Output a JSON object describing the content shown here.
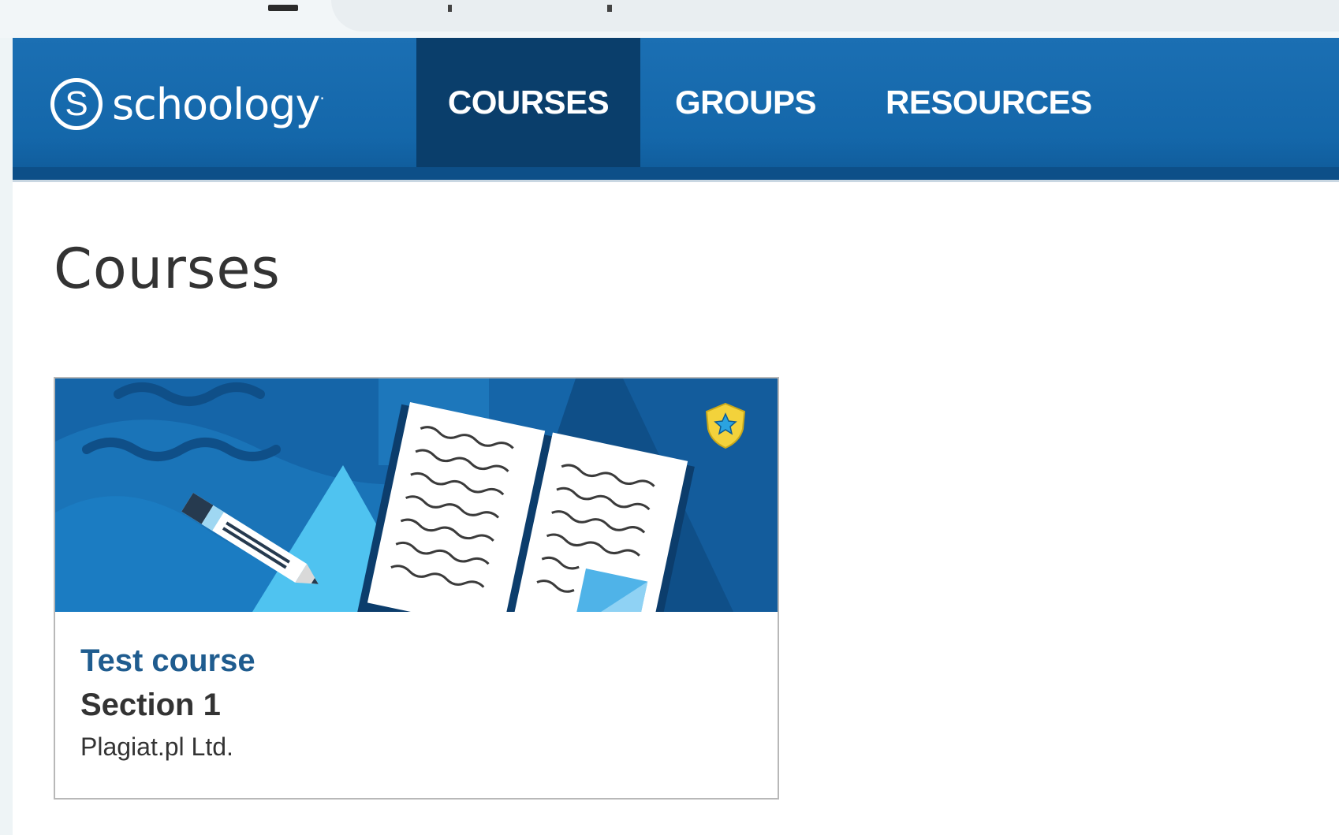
{
  "brand": {
    "logo_letter": "S",
    "name": "schoology",
    "trademark": "·"
  },
  "nav": {
    "tabs": [
      {
        "label": "COURSES",
        "active": true
      },
      {
        "label": "GROUPS",
        "active": false
      },
      {
        "label": "RESOURCES",
        "active": false
      }
    ]
  },
  "page": {
    "title": "Courses"
  },
  "courses": [
    {
      "name": "Test course",
      "section": "Section 1",
      "school": "Plagiat.pl Ltd."
    }
  ],
  "colors": {
    "nav_bg": "#1467aa",
    "nav_active": "#0a3e6b",
    "course_link": "#1f5c8f",
    "banner_bg": "#1565a8"
  },
  "icons": {
    "badge": "shield-star-icon"
  }
}
